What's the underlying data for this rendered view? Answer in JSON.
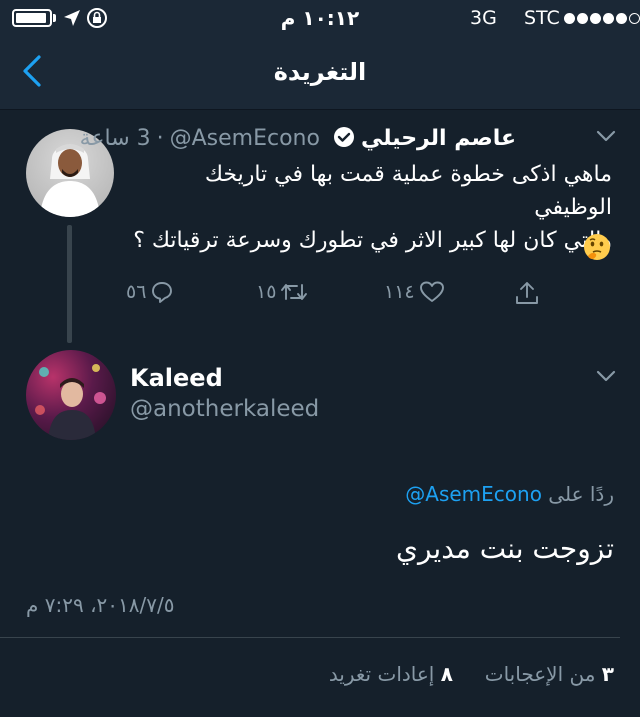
{
  "status_bar": {
    "time": "١٠:١٢ م",
    "network": "3G",
    "carrier": "STC",
    "signal_bars_filled": 5,
    "signal_bars_total": 6,
    "battery_icon": "battery-icon",
    "location_icon": "location-arrow-icon",
    "rotation_lock_icon": "rotation-lock-icon"
  },
  "nav": {
    "title": "التغريدة",
    "back_icon": "chevron-left-icon"
  },
  "original_tweet": {
    "author_name": "عاصم الرحيلي",
    "handle": "@AsemEcono",
    "separator": "·",
    "time_ago": "3 ساعة",
    "verified_icon": "verified-badge-icon",
    "text_line1": "ماهي اذكى خطوة عملية قمت بها في تاريخك الوظيفي",
    "text_line2": "والتي كان لها كبير الاثر في تطورك وسرعة ترقياتك ؟",
    "emoji": "thinking-face-emoji",
    "actions": {
      "replies": "٥٦",
      "retweets": "١٥",
      "likes": "١١٤"
    }
  },
  "reply_tweet": {
    "author_name": "Kaleed",
    "handle": "@anotherkaleed",
    "replying_to_label": "ردًا على",
    "replying_to_handle": "@AsemEcono",
    "text": "تزوجت بنت مديري",
    "date": "٢٠١٨/٧/٥، ٧:٢٩ م",
    "retweets_count": "٨",
    "retweets_label": "إعادات تغريد",
    "likes_count": "٣",
    "likes_label": "من الإعجابات"
  },
  "colors": {
    "background": "#15202b",
    "bar": "#1b2836",
    "muted": "#8899a6",
    "accent": "#1da1f2"
  }
}
